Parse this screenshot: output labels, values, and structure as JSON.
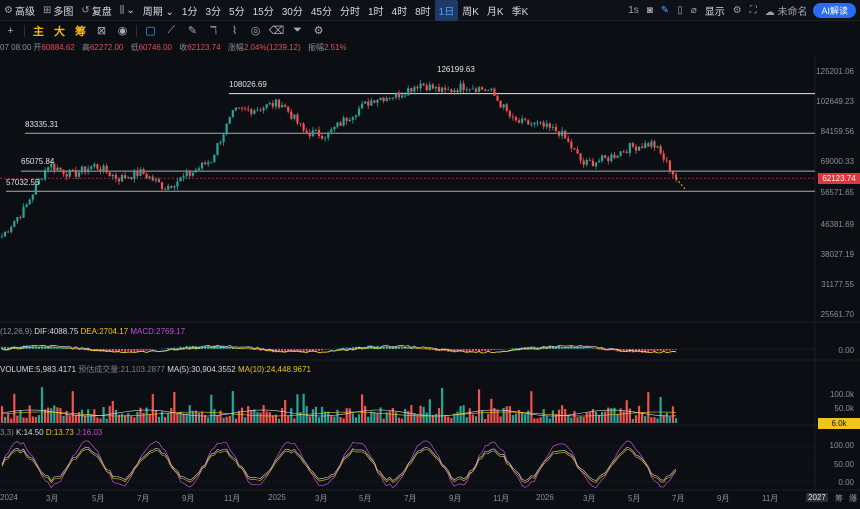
{
  "toolbar": {
    "items": [
      {
        "icon": "sliders-icon",
        "glyph": "⚙",
        "label": "高级"
      },
      {
        "icon": "grid-icon",
        "glyph": "⊞",
        "label": "多图"
      },
      {
        "icon": "replay-icon",
        "glyph": "↺",
        "label": "复盘"
      },
      {
        "icon": "candle-type-icon",
        "glyph": "⫼",
        "label": "⌄"
      },
      {
        "icon": "",
        "glyph": "",
        "label": "周期 ⌄"
      }
    ],
    "intervals": [
      "1分",
      "3分",
      "5分",
      "15分",
      "30分",
      "45分",
      "分时",
      "1时",
      "4时",
      "8时",
      "1日",
      "周K",
      "月K",
      "季K"
    ],
    "active_interval": "1日",
    "right": {
      "seconds_label": "1s",
      "show_label": "显示",
      "cloud_label": "未命名",
      "ai_label": "AI解读"
    }
  },
  "tools": {
    "labels": [
      "主",
      "大",
      "筹"
    ]
  },
  "ohlc": {
    "date": "07 08:00",
    "open_label": "开",
    "open": "60884.62",
    "high_label": "高",
    "high": "62272.00",
    "low_label": "低",
    "low": "60746.00",
    "close_label": "收",
    "close": "62123.74",
    "change_label": "涨幅",
    "change": "2.04%(1239.12)",
    "amp_label": "振幅",
    "amp": "2.51%"
  },
  "price_axis": [
    "125201.06",
    "102649.23",
    "84159.56",
    "69000.33",
    "56571.65",
    "46381.69",
    "38027.19",
    "31177.55",
    "25561.70"
  ],
  "current_price": "62123.74",
  "level_labels": [
    {
      "text": "126199.63"
    },
    {
      "text": "108026.69"
    },
    {
      "text": "83335.31"
    },
    {
      "text": "65075.84"
    },
    {
      "text": "57032.55"
    }
  ],
  "macd": {
    "title": "(12,26,9)",
    "dif_label": "DIF:",
    "dif": "4088.75",
    "dea_label": "DEA:",
    "dea": "2704.17",
    "macd_label": "MACD:",
    "macd": "2769.17",
    "axis": [
      "0.00"
    ]
  },
  "volume": {
    "title": "VOLUME:5,983.4171",
    "est_label": "预估成交量:21,103.2877",
    "ma5": "MA(5):30,904.3552",
    "ma10": "MA(10):24,448.9671",
    "axis": [
      "100.0k",
      "50.0k"
    ],
    "tag": "6.0k"
  },
  "kdj": {
    "title": "3,3)",
    "k": "K:14.50",
    "d": "D:13.73",
    "j": "J:16.03",
    "axis": [
      "100.00",
      "50.00",
      "0.00"
    ]
  },
  "x_axis": [
    "2024",
    "3月",
    "5月",
    "7月",
    "9月",
    "11月",
    "2025",
    "3月",
    "5月",
    "7月",
    "9月",
    "11月",
    "2026",
    "3月",
    "5月",
    "7月",
    "9月",
    "11月",
    "2027"
  ],
  "x_axis_right": [
    "筹",
    "爆"
  ],
  "colors": {
    "up": "#26a69a",
    "down": "#ef5350",
    "accent": "#2a6cf0",
    "price_tag": "#e0353f",
    "dif": "#d7dae0",
    "dea": "#f0c419",
    "kdj_j": "#c050d0"
  },
  "chart_data": {
    "type": "candlestick",
    "title": "",
    "ylim": [
      25561.7,
      125201.06
    ],
    "y_scale": "log",
    "series": [
      {
        "x": "2024-01",
        "y": 42500
      },
      {
        "x": "2024-02",
        "y": 51000
      },
      {
        "x": "2024-03",
        "y": 68000
      },
      {
        "x": "2024-04",
        "y": 63500
      },
      {
        "x": "2024-05",
        "y": 67500
      },
      {
        "x": "2024-06",
        "y": 62000
      },
      {
        "x": "2024-07",
        "y": 64500
      },
      {
        "x": "2024-08",
        "y": 58500
      },
      {
        "x": "2024-09",
        "y": 63300
      },
      {
        "x": "2024-10",
        "y": 70000
      },
      {
        "x": "2024-11",
        "y": 96000
      },
      {
        "x": "2024-12",
        "y": 98000
      },
      {
        "x": "2025-01",
        "y": 102000
      },
      {
        "x": "2025-02",
        "y": 84000
      },
      {
        "x": "2025-03",
        "y": 82500
      },
      {
        "x": "2025-04",
        "y": 94000
      },
      {
        "x": "2025-05",
        "y": 104500
      },
      {
        "x": "2025-06",
        "y": 107000
      },
      {
        "x": "2025-07",
        "y": 115500
      },
      {
        "x": "2025-08",
        "y": 109000
      },
      {
        "x": "2025-09",
        "y": 114000
      },
      {
        "x": "2025-10",
        "y": 110000
      },
      {
        "x": "2025-11",
        "y": 90000
      },
      {
        "x": "2025-12",
        "y": 88000
      },
      {
        "x": "2026-01",
        "y": 84000
      },
      {
        "x": "2026-02",
        "y": 68000
      },
      {
        "x": "2026-03",
        "y": 70500
      },
      {
        "x": "2026-04",
        "y": 76000
      },
      {
        "x": "2026-05",
        "y": 78000
      },
      {
        "x": "2026-06",
        "y": 62123.74
      }
    ],
    "horizontal_levels": [
      126199.63,
      108026.69,
      83335.31,
      65075.84,
      57032.55
    ]
  }
}
